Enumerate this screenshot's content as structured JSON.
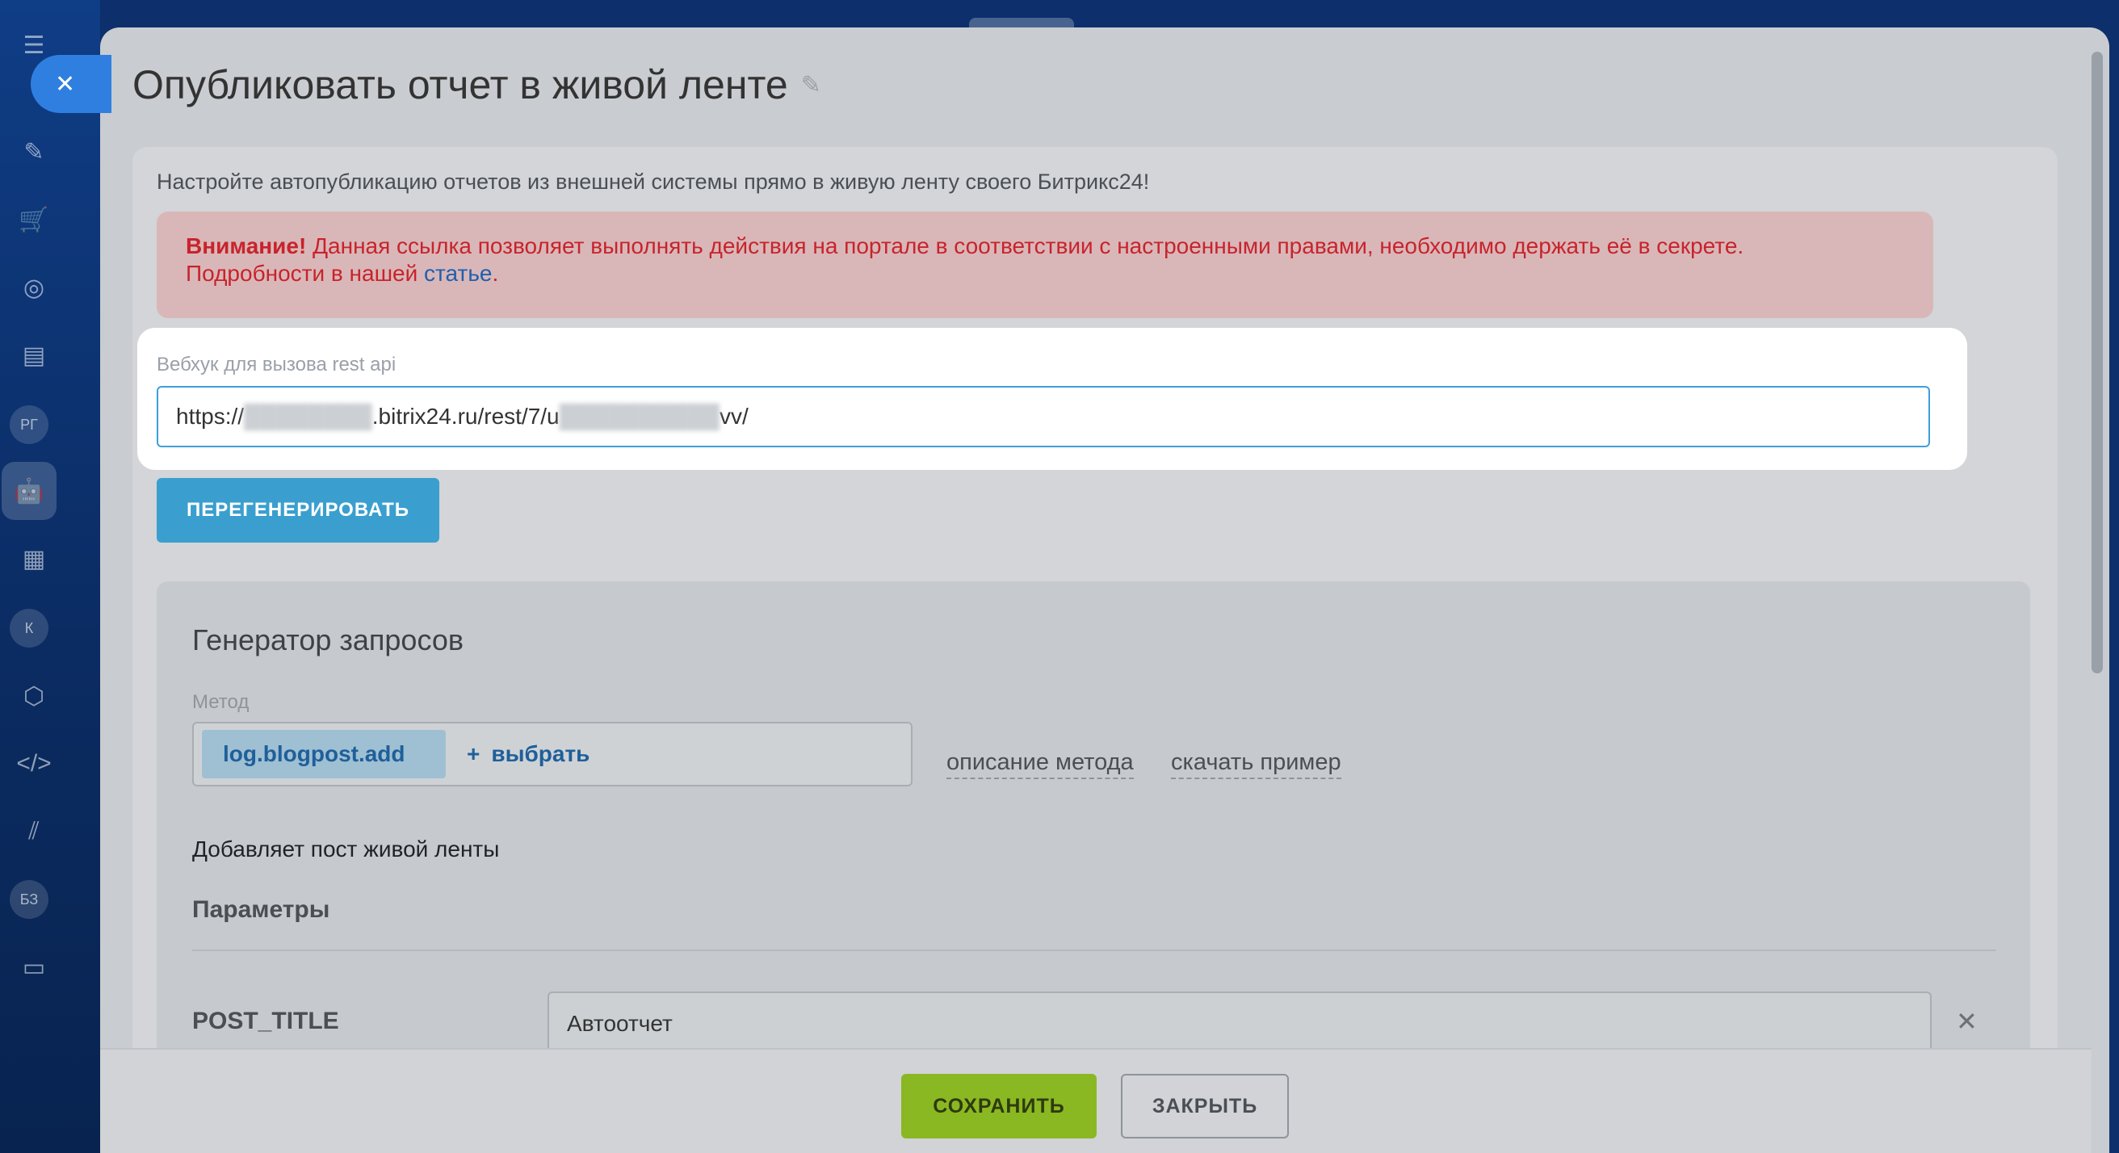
{
  "page": {
    "title": "Опубликовать отчет в живой ленте",
    "intro": "Настройте автопубликацию отчетов из внешней системы прямо в живую ленту своего Битрикс24!",
    "alert": {
      "bold": "Внимание!",
      "text": " Данная ссылка позволяет выполнять действия на портале в соответствии с настроенными правами, необходимо держать её в секрете.",
      "more_prefix": "Подробности в нашей ",
      "more_link": "статье",
      "more_suffix": "."
    },
    "webhook": {
      "label": "Вебхук для вызова rest api",
      "url_part1": "https://",
      "url_blur1": "████████",
      "url_part2": ".bitrix24.ru/rest/7/u",
      "url_blur2": "██████████",
      "url_part3": "vv/"
    },
    "regenerate_label": "ПЕРЕГЕНЕРИРОВАТЬ"
  },
  "generator": {
    "title": "Генератор запросов",
    "method_label": "Метод",
    "method_value": "log.blogpost.add",
    "choose_plus": "+",
    "choose_label": "выбрать",
    "method_doc_link": "описание метода",
    "download_example_link": "скачать пример",
    "method_description": "Добавляет пост живой ленты",
    "params_title": "Параметры",
    "params": [
      {
        "name": "POST_TITLE",
        "value": "Автоотчет"
      }
    ]
  },
  "footer": {
    "save_label": "СОХРАНИТЬ",
    "close_label": "ЗАКРЫТЬ"
  },
  "sidebar": {
    "badges": [
      "РГ",
      "К",
      "БЗ"
    ]
  },
  "colors": {
    "accent": "#3a9fcf",
    "save": "#8ab822",
    "alert_text": "#c8232c",
    "link": "#1f5fb0"
  }
}
